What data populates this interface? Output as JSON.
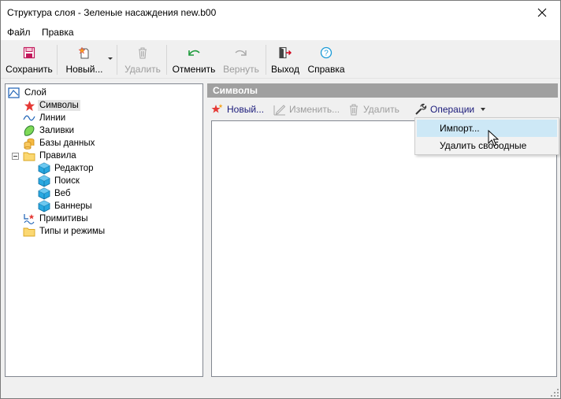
{
  "window": {
    "title": "Структура слоя - Зеленые насаждения new.b00",
    "close_icon": "close-icon"
  },
  "menu": [
    "Файл",
    "Правка"
  ],
  "toolbar": {
    "save": "Сохранить",
    "new": "Новый...",
    "delete": "Удалить",
    "undo": "Отменить",
    "redo": "Вернуть",
    "exit": "Выход",
    "help": "Справка"
  },
  "tree": {
    "root": "Слой",
    "items": [
      {
        "label": "Символы",
        "icon": "star-icon",
        "selected": true
      },
      {
        "label": "Линии",
        "icon": "line-icon"
      },
      {
        "label": "Заливки",
        "icon": "fill-icon"
      },
      {
        "label": "Базы данных",
        "icon": "database-icon"
      },
      {
        "label": "Правила",
        "icon": "folder-icon",
        "expanded": true
      },
      {
        "label": "Редактор",
        "icon": "cube-icon"
      },
      {
        "label": "Поиск",
        "icon": "cube-icon"
      },
      {
        "label": "Веб",
        "icon": "cube-icon"
      },
      {
        "label": "Баннеры",
        "icon": "cube-icon"
      },
      {
        "label": "Примитивы",
        "icon": "primitives-icon"
      },
      {
        "label": "Типы и режимы",
        "icon": "folder-icon"
      }
    ]
  },
  "panel": {
    "title": "Символы",
    "new": "Новый...",
    "edit": "Изменить...",
    "delete": "Удалить",
    "operations": "Операции"
  },
  "dropdown": {
    "items": [
      {
        "label": "Импорт...",
        "hover": true
      },
      {
        "label": "Удалить свободные"
      }
    ]
  },
  "colors": {
    "accent_selected": "#cde8f6",
    "panel_header": "#a0a0a0",
    "disabled_text": "#9d9d9d"
  }
}
